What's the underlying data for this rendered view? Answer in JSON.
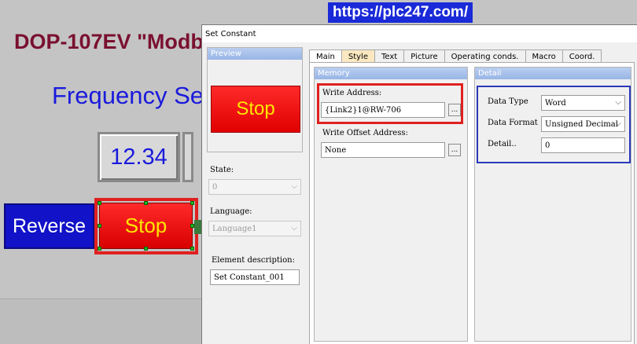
{
  "hmi": {
    "title": "DOP-107EV \"Modb",
    "frequency_label": "Frequency Se",
    "value": "12.34",
    "reverse_label": "Reverse",
    "stop_label": "Stop"
  },
  "watermark": {
    "url": "https://plc247.com/"
  },
  "dialog": {
    "title": "Set Constant",
    "preview": {
      "header": "Preview",
      "button_label": "Stop"
    },
    "state": {
      "label": "State:",
      "value": "0"
    },
    "language": {
      "label": "Language:",
      "value": "Language1"
    },
    "element_description": {
      "label": "Element description:",
      "value": "Set Constant_001"
    },
    "tabs": [
      {
        "label": "Main"
      },
      {
        "label": "Style"
      },
      {
        "label": "Text"
      },
      {
        "label": "Picture"
      },
      {
        "label": "Operating conds."
      },
      {
        "label": "Macro"
      },
      {
        "label": "Coord."
      }
    ],
    "memory": {
      "header": "Memory",
      "write_address_label": "Write Address:",
      "write_address_value": "{Link2}1@RW-706",
      "write_offset_label": "Write Offset Address:",
      "write_offset_value": "None",
      "browse_label": "..."
    },
    "detail": {
      "header": "Detail",
      "data_type_label": "Data Type",
      "data_type_value": "Word",
      "data_format_label": "Data Format",
      "data_format_value": "Unsigned Decimal",
      "detail_label": "Detail..",
      "detail_value": "0"
    }
  },
  "colors": {
    "hmi_title": "#7a1030",
    "hmi_text_blue": "#1a1adc",
    "stop_red": "#ff2a2a",
    "stop_text": "#ffe600",
    "highlight_red": "#e02020",
    "highlight_blue": "#2a3ab8",
    "watermark_bg": "#1a2ad8"
  },
  "icons": {
    "combo_arrow": "chevron-down-icon"
  }
}
